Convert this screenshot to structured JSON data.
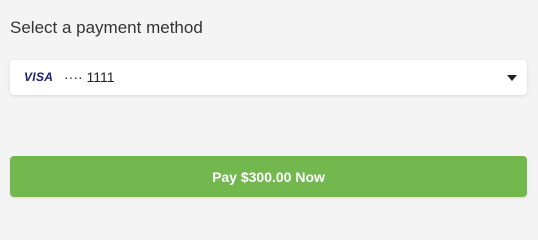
{
  "title": "Select a payment method",
  "payment_select": {
    "brand": "VISA",
    "masked_number": "···· 1111",
    "icon": "chevron-down-icon"
  },
  "pay_button": {
    "label": "Pay $300.00 Now"
  },
  "colors": {
    "background": "#f4f4f4",
    "button": "#72b84f",
    "visa_blue": "#1a1f71"
  }
}
